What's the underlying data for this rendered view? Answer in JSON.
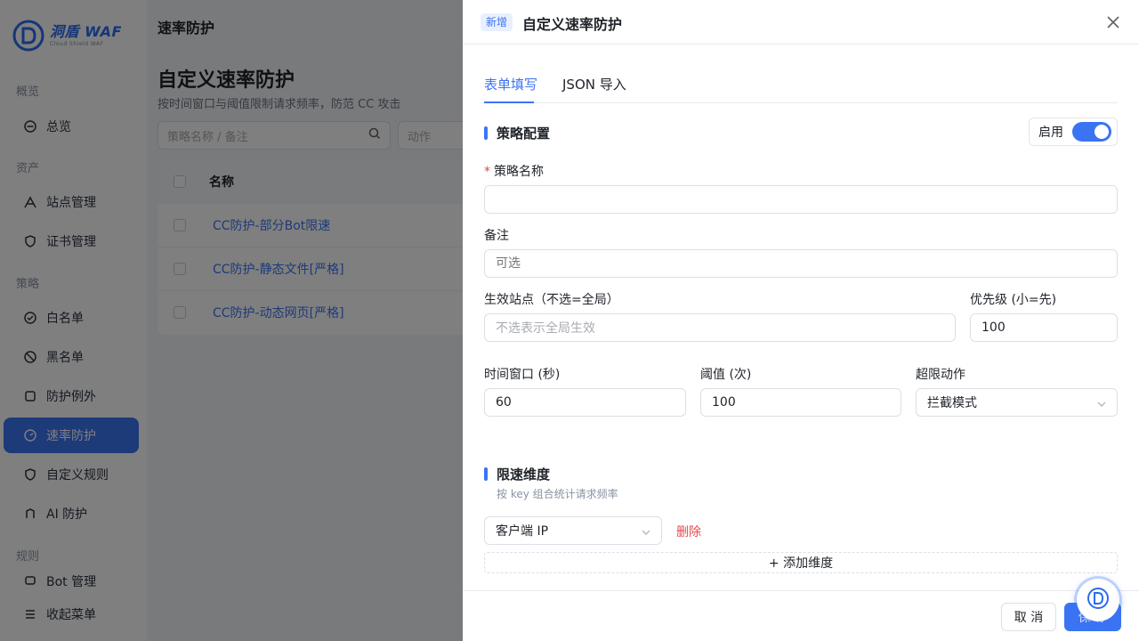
{
  "app": {
    "logo_title": "洞盾 WAF",
    "logo_sub": "Cloud Shield WAF",
    "breadcrumb": "速率防护",
    "page_title": "自定义速率防护",
    "page_subtitle": "按时间窗口与阈值限制请求频率，防范 CC 攻击",
    "filter_placeholder": "策略名称 / 备注",
    "filter_action_placeholder": "动作",
    "table_header_name": "名称",
    "rows": [
      {
        "name": "CC防护-部分Bot限速"
      },
      {
        "name": "CC防护-静态文件[严格]"
      },
      {
        "name": "CC防护-动态网页[严格]"
      }
    ]
  },
  "sidebar": {
    "groups": [
      "概览",
      "资产",
      "策略",
      "规则"
    ],
    "items": [
      {
        "label": "总览",
        "icon": "dashboard-icon"
      },
      {
        "label": "站点管理",
        "icon": "site-icon"
      },
      {
        "label": "证书管理",
        "icon": "shield-icon"
      },
      {
        "label": "白名单",
        "icon": "check-circle-icon"
      },
      {
        "label": "黑名单",
        "icon": "ban-icon"
      },
      {
        "label": "防护例外",
        "icon": "exception-icon"
      },
      {
        "label": "速率防护",
        "icon": "speed-icon"
      },
      {
        "label": "自定义规则",
        "icon": "shield-icon"
      },
      {
        "label": "AI 防护",
        "icon": "ai-icon"
      },
      {
        "label": "Bot 管理",
        "icon": "bot-icon"
      },
      {
        "label": "收起菜单",
        "icon": "collapse-icon"
      }
    ]
  },
  "drawer": {
    "badge": "新增",
    "title": "自定义速率防护",
    "tabs": [
      "表单填写",
      "JSON 导入"
    ],
    "section_policy": "策略配置",
    "enable_label": "启用",
    "enabled": true,
    "fields": {
      "name_label": "策略名称",
      "name_value": "",
      "remark_label": "备注",
      "remark_placeholder": "可选",
      "sites_label": "生效站点（不选=全局）",
      "sites_placeholder": "不选表示全局生效",
      "priority_label": "优先级 (小=先)",
      "priority_value": "100",
      "window_label": "时间窗口 (秒)",
      "window_value": "60",
      "threshold_label": "阈值 (次)",
      "threshold_value": "100",
      "action_label": "超限动作",
      "action_value": "拦截模式"
    },
    "section_dimension": "限速维度",
    "dimension_hint": "按 key 组合统计请求频率",
    "dimension_value": "客户端 IP",
    "delete_label": "删除",
    "add_dimension_label": "+ 添加维度",
    "cancel_label": "取 消",
    "save_label": "保 存"
  },
  "colors": {
    "primary": "#3b74f3",
    "danger": "#e5484d",
    "mask": "rgba(0,0,0,0.5)"
  }
}
